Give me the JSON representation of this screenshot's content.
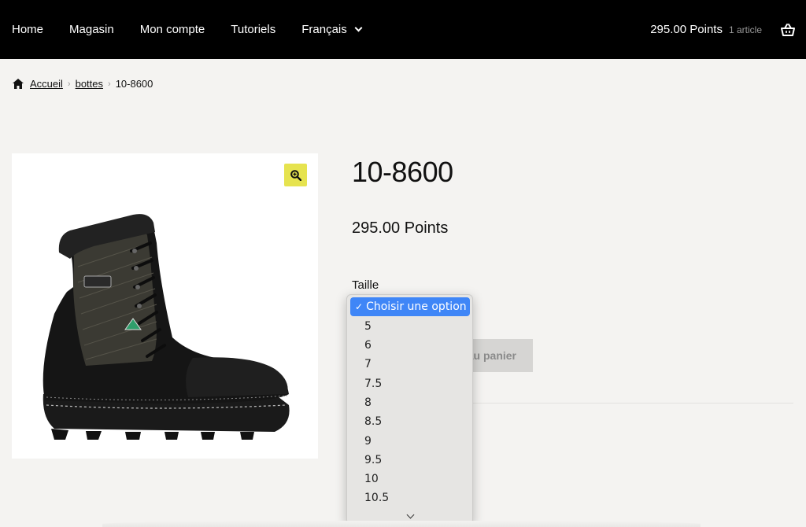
{
  "nav": {
    "items": [
      {
        "label": "Home"
      },
      {
        "label": "Magasin"
      },
      {
        "label": "Mon compte"
      },
      {
        "label": "Tutoriels"
      }
    ],
    "language": "Français"
  },
  "cart": {
    "total": "295.00  Points",
    "count": "1 article",
    "icon": "basket-icon"
  },
  "breadcrumb": {
    "home_icon": "home-icon",
    "home": "Accueil",
    "category": "bottes",
    "current": "10-8600"
  },
  "product": {
    "title": "10-8600",
    "price": "295.00  Points",
    "zoom_icon": "zoom-icon",
    "image": "black-safety-boot"
  },
  "variation": {
    "label": "Taille",
    "selected": "Choisir une option",
    "options": [
      "5",
      "6",
      "7",
      "7.5",
      "8",
      "8.5",
      "9",
      "9.5",
      "10",
      "10.5"
    ]
  },
  "add_to_cart": "Ajouter au panier",
  "colors": {
    "header_bg": "#000000",
    "page_bg": "#f4f3f1",
    "zoom_bg": "#e6e34f",
    "select_highlight": "#3f86f7"
  }
}
